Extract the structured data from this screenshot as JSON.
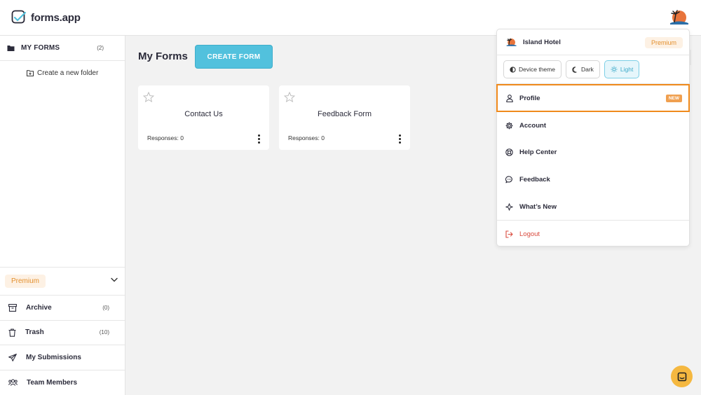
{
  "app": {
    "logo_text": "forms.app"
  },
  "sidebar": {
    "my_forms_label": "MY FORMS",
    "my_forms_count": "(2)",
    "new_folder_label": "Create a new folder",
    "premium_label": "Premium",
    "items": [
      {
        "label": "Archive",
        "count": "(0)",
        "icon": "archive-icon"
      },
      {
        "label": "Trash",
        "count": "(10)",
        "icon": "trash-icon"
      },
      {
        "label": "My Submissions",
        "count": "",
        "icon": "paper-plane-icon"
      },
      {
        "label": "Team Members",
        "count": "",
        "icon": "team-icon"
      }
    ]
  },
  "main": {
    "title": "My Forms",
    "create_button": "CREATE FORM",
    "forms": [
      {
        "name": "Contact Us",
        "responses": "Responses: 0"
      },
      {
        "name": "Feedback Form",
        "responses": "Responses: 0"
      }
    ]
  },
  "dropdown": {
    "user_name": "Island Hotel",
    "plan": "Premium",
    "themes": [
      {
        "label": "Device theme",
        "icon": "half-circle-icon",
        "active": false
      },
      {
        "label": "Dark",
        "icon": "moon-icon",
        "active": false
      },
      {
        "label": "Light",
        "icon": "sun-icon",
        "active": true
      }
    ],
    "items": [
      {
        "label": "Profile",
        "badge": "NEW",
        "icon": "user-icon"
      },
      {
        "label": "Account",
        "icon": "gear-icon"
      },
      {
        "label": "Help Center",
        "icon": "lifebuoy-icon"
      },
      {
        "label": "Feedback",
        "icon": "chat-bubble-icon"
      },
      {
        "label": "What’s New",
        "icon": "sparkle-icon"
      }
    ],
    "logout": "Logout"
  },
  "colors": {
    "accent": "#52c1dd",
    "premium_text": "#e3902e",
    "premium_bg": "#fdf1e4",
    "highlight_border": "#f08a1c",
    "logout": "#d94a3d",
    "chat_button": "#f5b840"
  }
}
